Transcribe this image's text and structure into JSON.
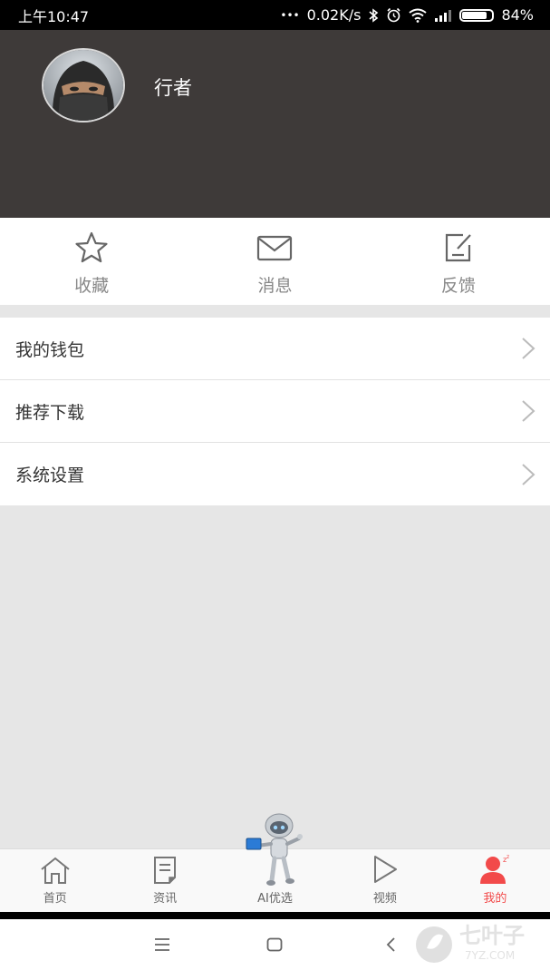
{
  "status_bar": {
    "time": "上午10:47",
    "dots": "•••",
    "speed": "0.02K/s",
    "battery": "84%",
    "battery_level": 0.84
  },
  "profile": {
    "username": "行者"
  },
  "quick_actions": [
    {
      "label": "收藏",
      "icon": "star-icon"
    },
    {
      "label": "消息",
      "icon": "mail-icon"
    },
    {
      "label": "反馈",
      "icon": "feedback-icon"
    }
  ],
  "menu": [
    {
      "label": "我的钱包"
    },
    {
      "label": "推荐下载"
    },
    {
      "label": "系统设置"
    }
  ],
  "tabs": [
    {
      "label": "首页",
      "icon": "home-icon",
      "active": false
    },
    {
      "label": "资讯",
      "icon": "news-icon",
      "active": false
    },
    {
      "label": "AI优选",
      "icon": "robot-icon",
      "active": false
    },
    {
      "label": "视频",
      "icon": "play-icon",
      "active": false
    },
    {
      "label": "我的",
      "icon": "user-icon",
      "active": true
    }
  ],
  "colors": {
    "header_bg": "#3e3a39",
    "accent": "#f24a4a",
    "page_bg": "#e6e6e6"
  },
  "watermark": {
    "brand": "七叶子",
    "domain": "7YZ.COM"
  }
}
